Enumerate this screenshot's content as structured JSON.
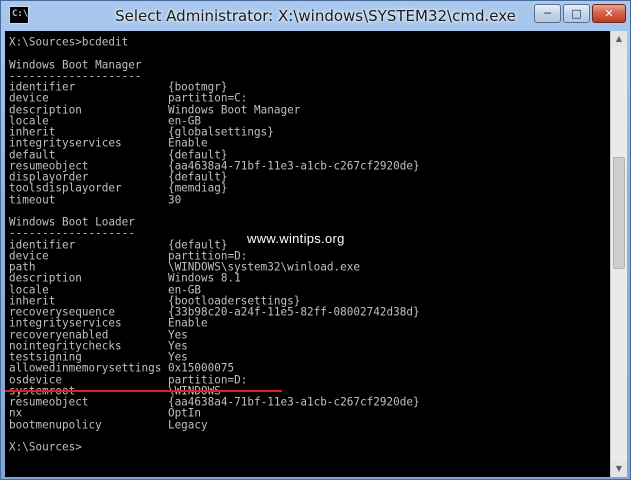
{
  "window": {
    "title": "Select Administrator: X:\\windows\\SYSTEM32\\cmd.exe",
    "icon_text": "C:\\",
    "controls": {
      "minimize": "─",
      "maximize": "□",
      "close": "✕"
    }
  },
  "console": {
    "lines": [
      "X:\\Sources>bcdedit",
      "",
      "Windows Boot Manager",
      "--------------------",
      "identifier              {bootmgr}",
      "device                  partition=C:",
      "description             Windows Boot Manager",
      "locale                  en-GB",
      "inherit                 {globalsettings}",
      "integrityservices       Enable",
      "default                 {default}",
      "resumeobject            {aa4638a4-71bf-11e3-a1cb-c267cf2920de}",
      "displayorder            {default}",
      "toolsdisplayorder       {memdiag}",
      "timeout                 30",
      "",
      "Windows Boot Loader",
      "-------------------",
      "identifier              {default}",
      "device                  partition=D:",
      "path                    \\WINDOWS\\system32\\winload.exe",
      "description             Windows 8.1",
      "locale                  en-GB",
      "inherit                 {bootloadersettings}",
      "recoverysequence        {33b98c20-a24f-11e5-82ff-08002742d38d}",
      "integrityservices       Enable",
      "recoveryenabled         Yes",
      "nointegritychecks       Yes",
      "testsigning             Yes",
      "allowedinmemorysettings 0x15000075",
      "osdevice                partition=D:",
      "systemroot              \\WINDOWS",
      "resumeobject            {aa4638a4-71bf-11e3-a1cb-c267cf2920de}",
      "nx                      OptIn",
      "bootmenupolicy          Legacy",
      "",
      "X:\\Sources>"
    ]
  },
  "watermark": "www.wintips.org",
  "colors": {
    "console_bg": "#000000",
    "console_text": "#c0c0c0",
    "highlight": "#e0201e"
  }
}
